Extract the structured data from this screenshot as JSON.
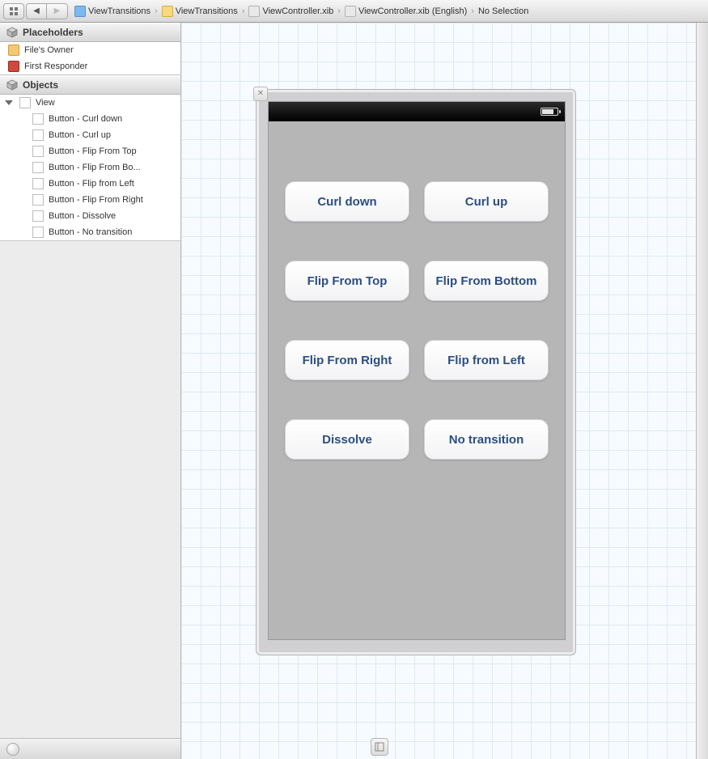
{
  "breadcrumb": {
    "items": [
      {
        "label": "ViewTransitions",
        "icon": "proj"
      },
      {
        "label": "ViewTransitions",
        "icon": "folder"
      },
      {
        "label": "ViewController.xib",
        "icon": "xib"
      },
      {
        "label": "ViewController.xib (English)",
        "icon": "xib"
      },
      {
        "label": "No Selection",
        "icon": ""
      }
    ]
  },
  "outline": {
    "placeholders_header": "Placeholders",
    "objects_header": "Objects",
    "placeholders": [
      {
        "label": "File's Owner",
        "icon": "owner"
      },
      {
        "label": "First Responder",
        "icon": "respond"
      }
    ],
    "view_label": "View",
    "objects": [
      {
        "label": "Button - Curl down"
      },
      {
        "label": "Button - Curl up"
      },
      {
        "label": "Button - Flip From Top"
      },
      {
        "label": "Button - Flip From Bo..."
      },
      {
        "label": "Button - Flip from Left"
      },
      {
        "label": "Button - Flip From Right"
      },
      {
        "label": "Button - Dissolve"
      },
      {
        "label": "Button - No transition"
      }
    ]
  },
  "canvas": {
    "buttons": [
      "Curl down",
      "Curl up",
      "Flip From Top",
      "Flip From Bottom",
      "Flip From Right",
      "Flip from Left",
      "Dissolve",
      "No transition"
    ]
  }
}
